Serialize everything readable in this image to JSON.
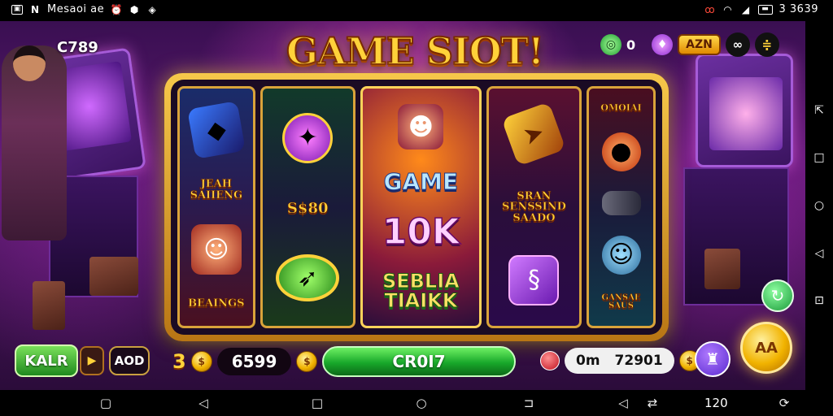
{
  "status_bar": {
    "left_text": "Mesaoi ae",
    "right_text": "3 3639",
    "icons_left": [
      "image-icon",
      "n-icon",
      "alarm-icon",
      "shield-icon",
      "bolt-icon"
    ],
    "icons_right": [
      "dnd-icon",
      "wifi-icon",
      "signal-icon",
      "battery-icon"
    ]
  },
  "hud": {
    "top_left_score": "C789",
    "title": "GAME SIOT!",
    "top_right": {
      "counter_value": "0",
      "badge_label": "AZN",
      "icons": [
        "green-coin-icon",
        "purple-gem-icon",
        "settings-icon",
        "menu-icon"
      ]
    }
  },
  "reels": {
    "r1": {
      "text": "JEAH SAIIENG",
      "bottom_text": "BEAINGS"
    },
    "r2": {
      "text": "S$80"
    },
    "r3": {
      "top_text": "GAME",
      "mid_text": "10K",
      "bottom_text": "SEBLIA TIAIKK"
    },
    "r4": {
      "text": "SRAN SENSSIND SAADO"
    },
    "r5": {
      "top_text": "OMOIAI",
      "bottom_text": "GANSAE SAUS"
    }
  },
  "controls": {
    "left_button": "KALR",
    "aod_button": "AOD",
    "balance_prefix": "3",
    "balance_value": "6599",
    "spin_label": "CR0I7",
    "right_label": "0m",
    "right_value": "72901",
    "bet_button": "AA"
  },
  "nav_bar": {
    "right_text": "120"
  },
  "colors": {
    "gold": "#ffd23a",
    "spin_green": "#18a82a",
    "purple_bg": "#5a1a6e"
  }
}
